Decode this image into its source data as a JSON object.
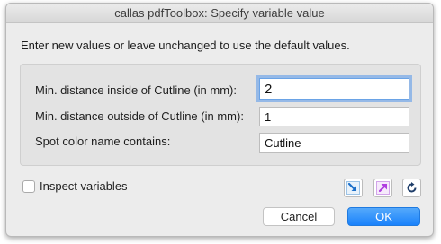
{
  "window": {
    "title": "callas pdfToolbox: Specify variable value"
  },
  "dialog": {
    "instruction": "Enter new values or leave unchanged to use the default values."
  },
  "fields": [
    {
      "label": "Min. distance inside of Cutline (in mm):",
      "value": "2"
    },
    {
      "label": "Min. distance outside of Cutline (in mm):",
      "value": "1"
    },
    {
      "label": "Spot color name contains:",
      "value": "Cutline"
    }
  ],
  "options": {
    "inspect_label": "Inspect variables",
    "inspect_checked": false
  },
  "toolbar_icons": [
    "import-arrow-icon",
    "export-arrow-icon",
    "reset-icon"
  ],
  "buttons": {
    "cancel": "Cancel",
    "ok": "OK"
  },
  "colors": {
    "accent": "#1a82fb",
    "focus_ring": "#5698eb"
  }
}
